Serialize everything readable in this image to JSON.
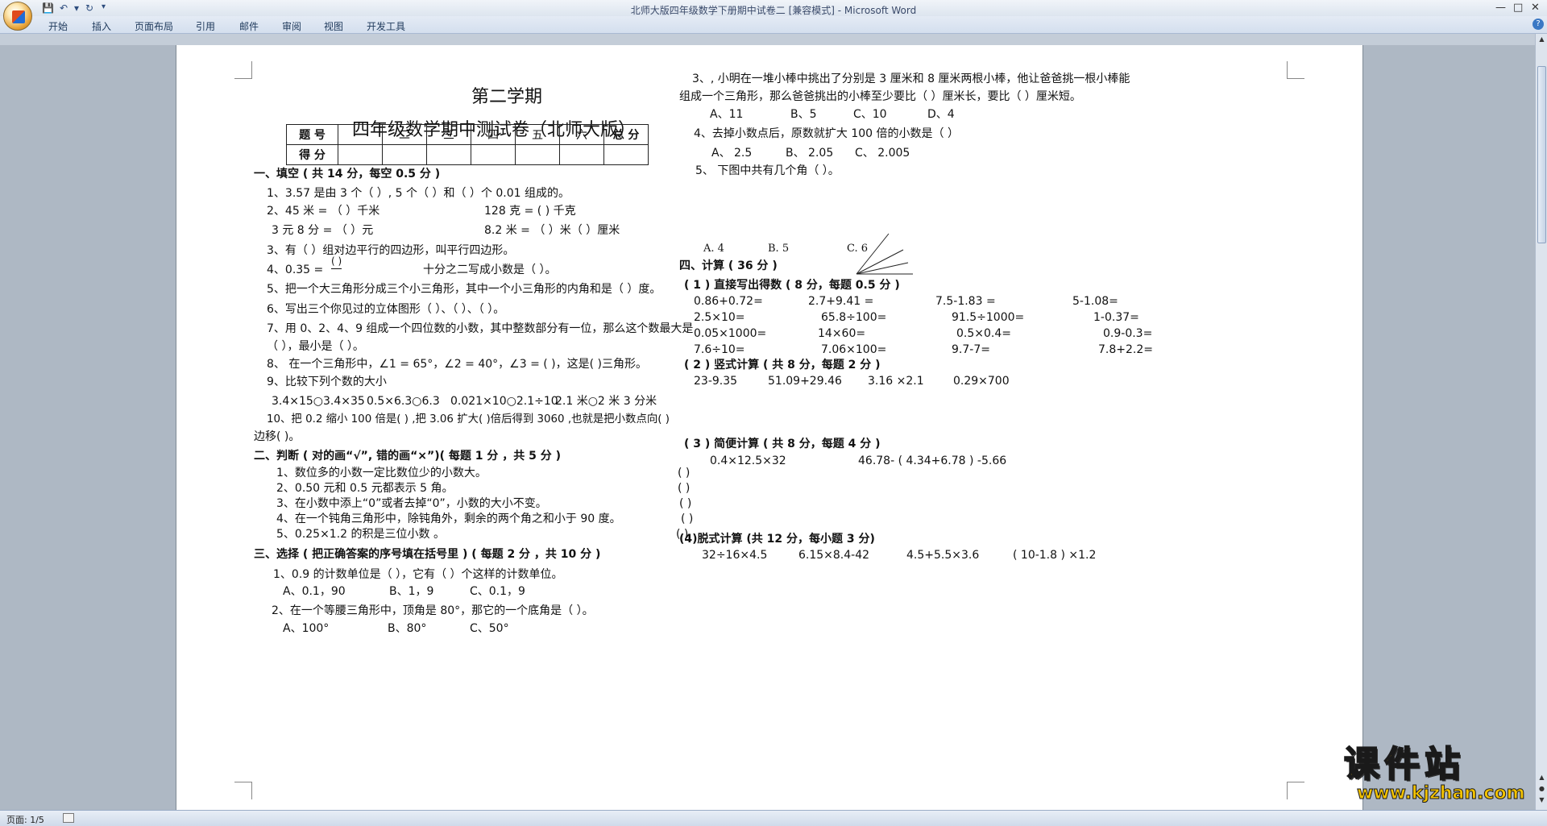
{
  "window": {
    "title": "北师大版四年级数学下册期中试卷二 [兼容模式] - Microsoft Word"
  },
  "ribbon": {
    "tabs": [
      "开始",
      "插入",
      "页面布局",
      "引用",
      "邮件",
      "审阅",
      "视图",
      "开发工具"
    ]
  },
  "status": {
    "page": "页面: 1/5"
  },
  "watermark": {
    "brand": "课件站",
    "url": "www.kjzhan.com"
  },
  "doc": {
    "head1": "第二学期",
    "head2": "四年级数学期中测试卷（北师大版）",
    "score_header": [
      "题  号",
      "一",
      "二",
      "三",
      "四",
      "五",
      "六",
      "总  分"
    ],
    "score_row_label": "得  分",
    "s1_title": "一、填空 ( 共 14 分，每空 0.5 分 )",
    "s1_q1": "1、3.57 是由 3 个（      ）, 5 个（      ）和（      ）个 0.01 组成的。",
    "s1_q2a": "2、45 米 =  （        ）千米",
    "s1_q2b": "128 克 = (          ) 千克",
    "s1_q2c": "3 元 8 分 = （         ）元",
    "s1_q2d": "8.2 米 = （        ）米（         ）厘米",
    "s1_q3": "3、有（          ）组对边平行的四边形，叫平行四边形。",
    "s1_q4a": "4、0.35 =",
    "s1_q4frac": "(     )",
    "s1_q4b": "十分之二写成小数是（        ）。",
    "s1_q5": "5、把一个大三角形分成三个小三角形，其中一个小三角形的内角和是（          ）度。",
    "s1_q6": "6、写出三个你见过的立体图形（                   ）、（                ）、（                ）。",
    "s1_q7a": "7、用 0、2、4、9 组成一个四位数的小数，其中整数部分有一位，那么这个数最大是",
    "s1_q7b": "（              ），最小是（                ）。",
    "s1_q8": "8、 在一个三角形中，∠1 = 65°，∠2 = 40°，∠3 = (      )，这是(      )三角形。",
    "s1_q9": "9、比较下列个数的大小",
    "s1_q9a": "3.4×15○3.4×35",
    "s1_q9b": "0.5×6.3○6.3",
    "s1_q9c": "0.021×10○2.1÷10",
    "s1_q9d": "2.1 米○2 米 3 分米",
    "s1_q10a": "10、把 0.2 缩小 100 倍是(      ) ,把 3.06 扩大(      )倍后得到 3060 ,也就是把小数点向(      )",
    "s1_q10b": "边移(      )。",
    "s2_title": "二、判断 ( 对的画“√”, 错的画“×”)( 每题 1 分 ，共 5 分 )",
    "s2_items": [
      "1、数位多的小数一定比数位少的小数大。",
      "2、0.50 元和 0.5 元都表示 5 角。",
      "3、在小数中添上“0”或者去掉“0”，小数的大小不变。",
      "4、在一个钝角三角形中，除钝角外，剩余的两个角之和小于 90 度。",
      "5、0.25×1.2 的积是三位小数 。"
    ],
    "s2_paren": "(          )",
    "s3_title": "三、选择 ( 把正确答案的序号填在括号里 ) ( 每题 2 分 ，共 10 分 )",
    "s3_q1": "1、0.9 的计数单位是（      ），它有（      ）个这样的计数单位。",
    "s3_q1o": [
      "A、0.1，90",
      "B、1，9",
      "C、0.1，9"
    ],
    "s3_q2": "2、在一个等腰三角形中，顶角是 80°，那它的一个底角是（        ）。",
    "s3_q2o": [
      "A、100°",
      "B、80°",
      "C、50°"
    ],
    "s3_q3a": "3、, 小明在一堆小棒中挑出了分别是 3 厘米和 8 厘米两根小棒，他让爸爸挑一根小棒能",
    "s3_q3b": "组成一个三角形，那么爸爸挑出的小棒至少要比（        ）厘米长，要比（        ）厘米短。",
    "s3_q3o": [
      "A、11",
      "B、5",
      "C、10",
      "D、4"
    ],
    "s3_q4": "4、去掉小数点后，原数就扩大 100 倍的小数是（      ）",
    "s3_q4o": [
      "A、 2.5",
      "B、 2.05",
      "C、 2.005"
    ],
    "s3_q5": "5、 下图中共有几个角（        ）。",
    "s3_q5o": [
      "A. 4",
      "B. 5",
      "C. 6"
    ],
    "s4_title": "四、计算 ( 36 分 )",
    "s4_1_title": "( 1 ) 直接写出得数 ( 8 分，每题 0.5 分 )",
    "s4_1_rows": [
      [
        "0.86+0.72=",
        "2.7+9.41 =",
        "7.5-1.83 =",
        "5-1.08="
      ],
      [
        "2.5×10=",
        "65.8÷100=",
        "91.5÷1000=",
        "1-0.37="
      ],
      [
        "0.05×1000=",
        "14×60=",
        "0.5×0.4=",
        "0.9-0.3="
      ],
      [
        "7.6÷10=",
        "7.06×100=",
        "9.7-7=",
        "7.8+2.2="
      ]
    ],
    "s4_2_title": "( 2 ) 竖式计算 ( 共 8 分，每题 2 分 )",
    "s4_2_items": [
      "23-9.35",
      "51.09+29.46",
      "3.16 ×2.1",
      "0.29×700"
    ],
    "s4_3_title": "( 3 ) 简便计算 ( 共 8 分，每题 4 分 )",
    "s4_3_items": [
      "0.4×12.5×32",
      "46.78- ( 4.34+6.78 ) -5.66"
    ],
    "s4_4_title": "(4)脱式计算 (共 12 分，每小题 3 分)",
    "s4_4_items": [
      "32÷16×4.5",
      "6.15×8.4-42",
      "4.5+5.5×3.6",
      "( 10-1.8 ) ×1.2"
    ]
  }
}
